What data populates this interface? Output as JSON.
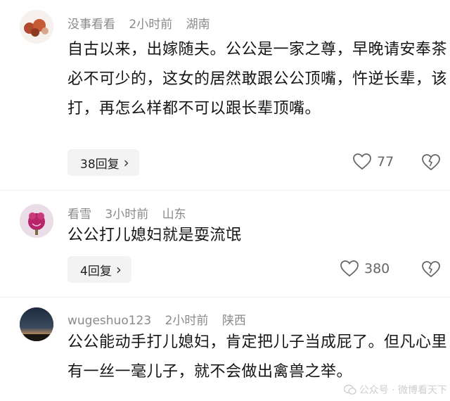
{
  "comments": [
    {
      "user": "没事看看",
      "time": "2小时前",
      "location": "湖南",
      "text": "自古以来，出嫁随夫。公公是一家之尊，早晚请安奉茶必不可少的，这女的居然敢跟公公顶嘴，忤逆长辈，该打，再怎么样都不可以跟长辈顶嘴。",
      "replies": "38回复",
      "likes": "77"
    },
    {
      "user": "看雪",
      "time": "3小时前",
      "location": "山东",
      "text": "公公打儿媳妇就是耍流氓",
      "replies": "4回复",
      "likes": "380"
    },
    {
      "user": "wugeshuo123",
      "time": "2小时前",
      "location": "陕西",
      "text": "公公能动手打儿媳妇，肯定把儿子当成屁了。但凡心里有一丝一毫儿子，就不会做出禽兽之举。",
      "replies": "",
      "likes": ""
    }
  ],
  "watermark": "公众号 · 微博看天下"
}
